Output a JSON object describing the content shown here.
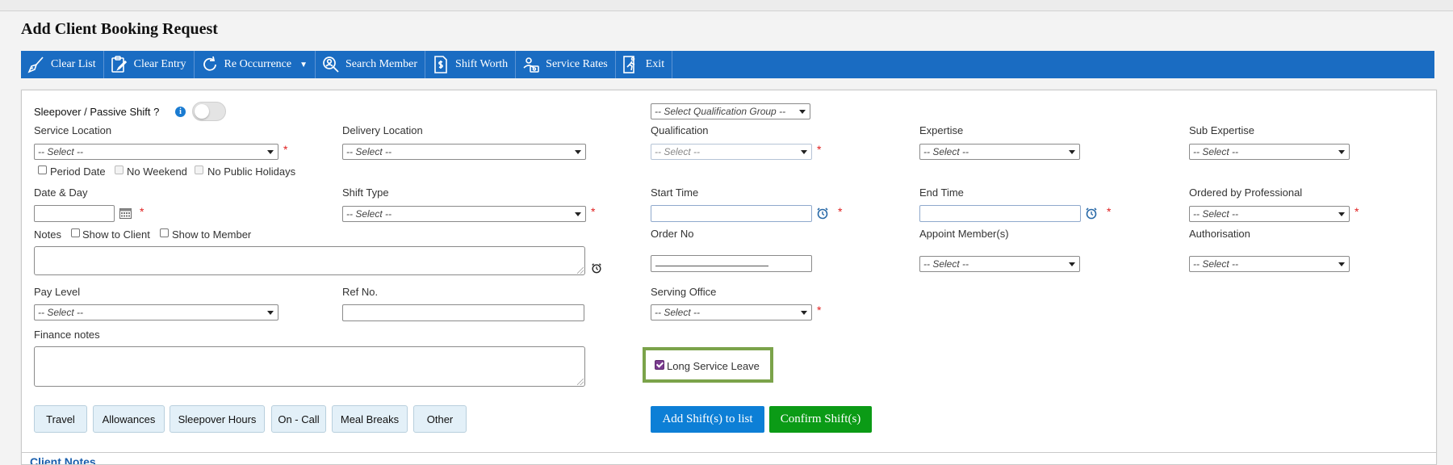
{
  "page_title": "Add Client Booking Request",
  "toolbar": {
    "clear_list": "Clear List",
    "clear_entry": "Clear Entry",
    "re_occurrence": "Re Occurrence",
    "search_member": "Search Member",
    "shift_worth": "Shift Worth",
    "service_rates": "Service Rates",
    "exit": "Exit"
  },
  "form": {
    "sleepover_label": "Sleepover / Passive Shift ?",
    "qualification_group_select": "-- Select Qualification Group --",
    "service_location": {
      "label": "Service Location",
      "value": "-- Select --"
    },
    "delivery_location": {
      "label": "Delivery Location",
      "value": "-- Select --"
    },
    "qualification": {
      "label": "Qualification",
      "value": "-- Select --"
    },
    "expertise": {
      "label": "Expertise",
      "value": "-- Select --"
    },
    "sub_expertise": {
      "label": "Sub Expertise",
      "value": "-- Select --"
    },
    "period_date": "Period Date",
    "no_weekend": "No Weekend",
    "no_public_holidays": "No Public Holidays",
    "date_day": {
      "label": "Date & Day",
      "value": ""
    },
    "shift_type": {
      "label": "Shift Type",
      "value": "-- Select --"
    },
    "start_time": {
      "label": "Start Time",
      "value": ""
    },
    "end_time": {
      "label": "End Time",
      "value": ""
    },
    "ordered_by": {
      "label": "Ordered by Professional",
      "value": "-- Select --"
    },
    "notes_label": "Notes",
    "show_to_client": "Show to Client",
    "show_to_member": "Show to Member",
    "order_no": {
      "label": "Order No"
    },
    "appoint_members": {
      "label": "Appoint Member(s)",
      "value": "-- Select --"
    },
    "authorisation": {
      "label": "Authorisation",
      "value": "-- Select --"
    },
    "pay_level": {
      "label": "Pay Level",
      "value": "-- Select --"
    },
    "ref_no": {
      "label": "Ref No.",
      "value": ""
    },
    "serving_office": {
      "label": "Serving Office",
      "value": "-- Select --"
    },
    "finance_notes_label": "Finance notes",
    "long_service_leave": "Long Service Leave",
    "long_service_leave_checked": true,
    "required_mark": "*"
  },
  "extras": [
    "Travel",
    "Allowances",
    "Sleepover Hours",
    "On - Call",
    "Meal Breaks",
    "Other"
  ],
  "actions": {
    "add_shifts": "Add Shift(s) to list",
    "confirm_shifts": "Confirm Shift(s)"
  },
  "bottom_section_label": "Client Notes"
}
